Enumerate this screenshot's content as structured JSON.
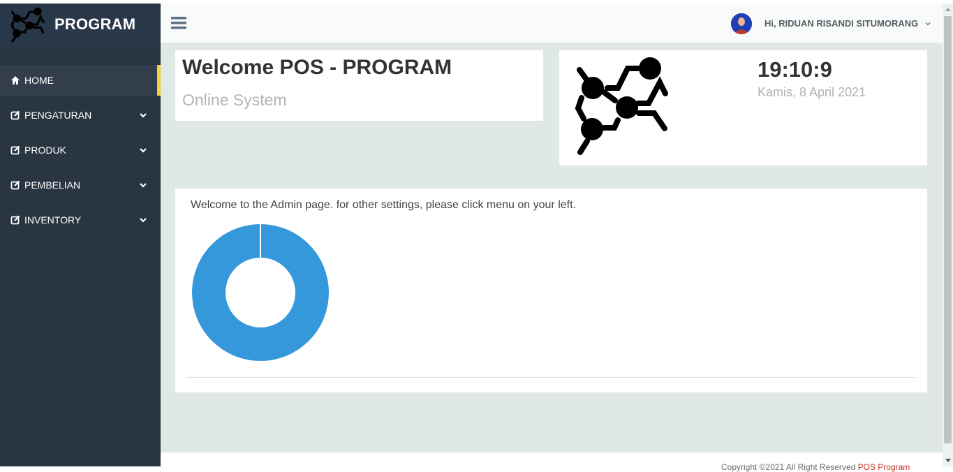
{
  "brand": {
    "name": "PROGRAM",
    "logo_icon": "molecule-logo-icon"
  },
  "sidebar": {
    "items": [
      {
        "label": "HOME",
        "icon": "home-icon",
        "active": true
      },
      {
        "label": "PENGATURAN",
        "icon": "edit-icon",
        "submenu": true
      },
      {
        "label": "PRODUK",
        "icon": "edit-icon",
        "submenu": true
      },
      {
        "label": "PEMBELIAN",
        "icon": "edit-icon",
        "submenu": true
      },
      {
        "label": "INVENTORY",
        "icon": "edit-icon",
        "submenu": true
      }
    ]
  },
  "header": {
    "menu_icon": "hamburger-icon",
    "user_greeting": "Hi, RIDUAN RISANDI SITUMORANG"
  },
  "welcome": {
    "title": "Welcome POS - PROGRAM",
    "subtitle": "Online System"
  },
  "clock": {
    "time": "19:10:9",
    "date": "Kamis, 8 April 2021"
  },
  "main": {
    "message": "Welcome to the Admin page. for other settings, please click menu on your left."
  },
  "chart_data": {
    "type": "pie",
    "values": [
      100
    ],
    "colors": [
      "#3498db"
    ]
  },
  "footer": {
    "text": "Copyright ©2021 All Right Reserved ",
    "link": "POS Program"
  },
  "colors": {
    "sidebar": "#2a3542",
    "accent": "#f4d03f",
    "chart": "#3498db",
    "content_bg": "#e0e8e6"
  }
}
